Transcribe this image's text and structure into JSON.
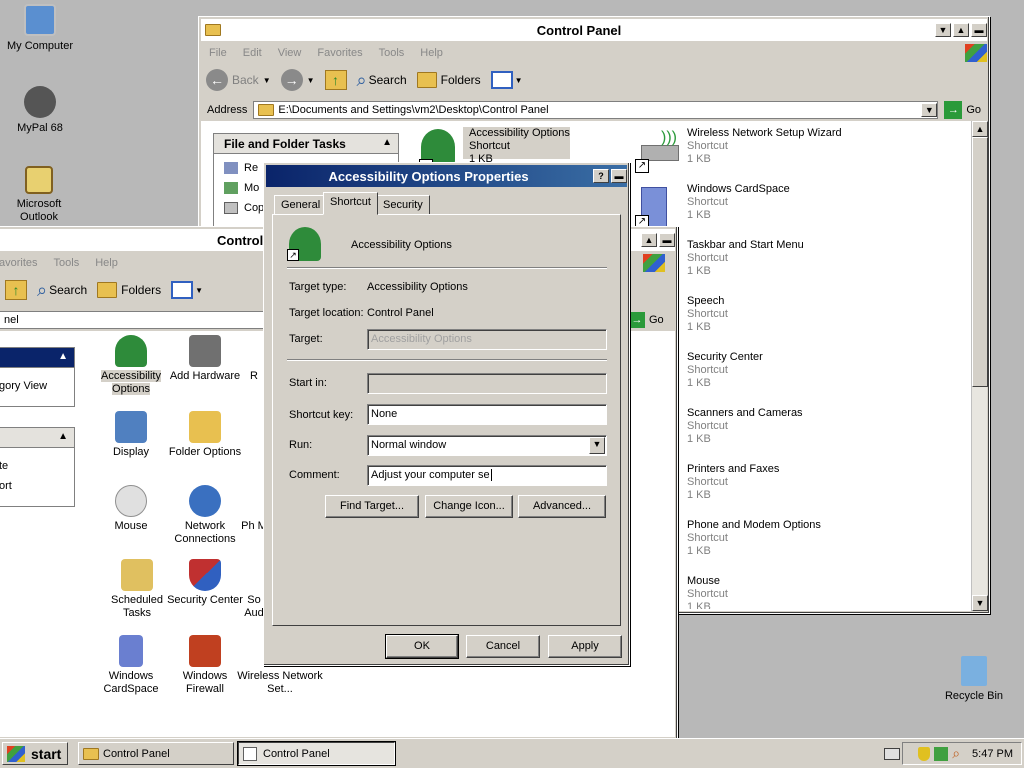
{
  "desktop": {
    "icons": [
      {
        "label": "My Computer",
        "icon": "my-computer-icon"
      },
      {
        "label": "MyPal 68",
        "icon": "mypal-icon"
      },
      {
        "label": "Microsoft Outlook",
        "icon": "outlook-icon"
      },
      {
        "label": "Recycle Bin",
        "icon": "recycle-bin-icon"
      }
    ]
  },
  "back_window": {
    "title": "Control Panel",
    "menu": [
      "File",
      "Edit",
      "View",
      "Favorites",
      "Tools",
      "Help"
    ],
    "toolbar": {
      "back": "Back",
      "search": "Search",
      "folders": "Folders"
    },
    "address_label": "Address",
    "address_value": "E:\\Documents and Settings\\vm2\\Desktop\\Control Panel",
    "go_label": "Go",
    "task_panel_title": "File and Folder Tasks",
    "task_panel_items": [
      "Re",
      "Mo",
      "Cop"
    ],
    "items": [
      {
        "name": "Accessibility Options",
        "type": "Shortcut",
        "size": "1 KB",
        "color": "#2e8b3a"
      },
      {
        "name": "Wireless Network Setup Wizard",
        "type": "Shortcut",
        "size": "1 KB",
        "color": "#5a8fd0"
      },
      {
        "name": "Windows CardSpace",
        "type": "Shortcut",
        "size": "1 KB",
        "color": "#6a7fd0"
      },
      {
        "name": "Taskbar and Start Menu",
        "type": "Shortcut",
        "size": "1 KB",
        "color": "#4a70b0"
      },
      {
        "name": "Speech",
        "type": "Shortcut",
        "size": "1 KB",
        "color": "#c04040"
      },
      {
        "name": "Security Center",
        "type": "Shortcut",
        "size": "1 KB",
        "color": "#c03030"
      },
      {
        "name": "Scanners and Cameras",
        "type": "Shortcut",
        "size": "1 KB",
        "color": "#707070"
      },
      {
        "name": "Printers and Faxes",
        "type": "Shortcut",
        "size": "1 KB",
        "color": "#606060"
      },
      {
        "name": "Phone and Modem Options",
        "type": "Shortcut",
        "size": "1 KB",
        "color": "#808080"
      },
      {
        "name": "Mouse",
        "type": "Shortcut",
        "size": "1 KB",
        "color": "#909090"
      }
    ]
  },
  "mid_window": {
    "title": "Control",
    "menu": [
      "avorites",
      "Tools",
      "Help"
    ],
    "toolbar": {
      "search": "Search",
      "folders": "Folders"
    },
    "address_value": "nel",
    "go_label": "Go",
    "panel1_items": [
      "gory View"
    ],
    "panel2_items": [
      "te",
      "ort"
    ],
    "icons": [
      {
        "label": "Accessibility Options",
        "color": "#2e8b3a"
      },
      {
        "label": "Add Hardware",
        "color": "#707070"
      },
      {
        "label": "R",
        "color": "#ffffff"
      },
      {
        "label": "Display",
        "color": "#5080c0"
      },
      {
        "label": "Folder Options",
        "color": "#e8c050"
      },
      {
        "label": "Mouse",
        "color": "#c8c8c8"
      },
      {
        "label": "Network Connections",
        "color": "#3a70c0"
      },
      {
        "label": "Ph M",
        "color": "#ffffff"
      },
      {
        "label": "Scheduled Tasks",
        "color": "#e0c060"
      },
      {
        "label": "Security Center",
        "color": "#c03030"
      },
      {
        "label": "So Aud",
        "color": "#ffffff"
      },
      {
        "label": "Windows CardSpace",
        "color": "#6a7fd0"
      },
      {
        "label": "Windows Firewall",
        "color": "#c04020"
      },
      {
        "label": "Wireless Network Set...",
        "color": "#ffffff"
      }
    ]
  },
  "dialog": {
    "title": "Accessibility Options Properties",
    "tabs": [
      "General",
      "Shortcut",
      "Security"
    ],
    "name": "Accessibility Options",
    "target_type_label": "Target type:",
    "target_type_value": "Accessibility Options",
    "target_location_label": "Target location:",
    "target_location_value": "Control Panel",
    "target_label": "Target:",
    "target_value": "Accessibility Options",
    "start_in_label": "Start in:",
    "start_in_value": "",
    "shortcut_key_label": "Shortcut key:",
    "shortcut_key_value": "None",
    "run_label": "Run:",
    "run_value": "Normal window",
    "comment_label": "Comment:",
    "comment_value": "Adjust your computer se",
    "find_target": "Find Target...",
    "change_icon": "Change Icon...",
    "advanced": "Advanced...",
    "ok": "OK",
    "cancel": "Cancel",
    "apply": "Apply"
  },
  "taskbar": {
    "start": "start",
    "tasks": [
      "Control Panel",
      "Control Panel"
    ],
    "clock": "5:47 PM"
  },
  "colors": {
    "title_active": "#0a246a",
    "face": "#d4d0c8",
    "desktop": "#b8b8b8"
  }
}
